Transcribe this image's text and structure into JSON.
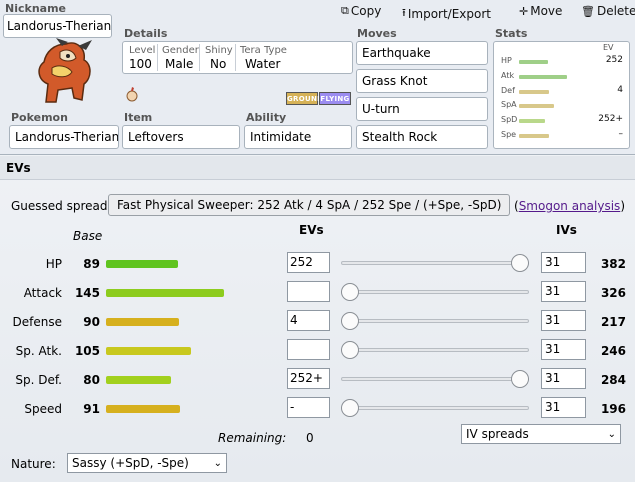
{
  "toolbar": {
    "copy": "Copy",
    "import_export": "Import/Export",
    "move": "Move",
    "delete": "Delete"
  },
  "set": {
    "nickname_label": "Nickname",
    "nickname": "Landorus-Therian",
    "details_label": "Details",
    "level_label": "Level",
    "level": "100",
    "gender_label": "Gender",
    "gender": "Male",
    "shiny_label": "Shiny",
    "shiny": "No",
    "tera_label": "Tera Type",
    "tera": "Water",
    "types": [
      "GROUND",
      "FLYING"
    ],
    "type_colors": [
      "#d6b257",
      "#9b8cf0"
    ],
    "pokemon_label": "Pokemon",
    "pokemon": "Landorus-Therian",
    "item_label": "Item",
    "item": "Leftovers",
    "ability_label": "Ability",
    "ability": "Intimidate",
    "moves_label": "Moves",
    "moves": [
      "Earthquake",
      "Grass Knot",
      "U-turn",
      "Stealth Rock"
    ],
    "stats_label": "Stats",
    "ev_label": "EV",
    "mini_stats": [
      {
        "name": "HP",
        "ev": "252"
      },
      {
        "name": "Atk",
        "ev": ""
      },
      {
        "name": "Def",
        "ev": "4"
      },
      {
        "name": "SpA",
        "ev": ""
      },
      {
        "name": "SpD",
        "ev": "252+"
      },
      {
        "name": "Spe",
        "ev": "–"
      }
    ]
  },
  "evs": {
    "header": "EVs",
    "guessed_label": "Guessed spread:",
    "guessed_value": "Fast Physical Sweeper: 252 Atk / 4 SpA / 252 Spe / (+Spe, -SpD)",
    "smogon_paren_open": "(",
    "smogon_link": "Smogon analysis",
    "smogon_paren_close": ")",
    "base_header": "Base",
    "evs_header": "EVs",
    "ivs_header": "IVs",
    "rows": [
      {
        "name": "HP",
        "base": "89",
        "ev": "252",
        "iv": "31",
        "total": "382",
        "ev_fraction": 1.0,
        "bar_color": "#5fc41f"
      },
      {
        "name": "Attack",
        "base": "145",
        "ev": "",
        "iv": "31",
        "total": "326",
        "ev_fraction": 0.0,
        "bar_color": "#8dcc1e"
      },
      {
        "name": "Defense",
        "base": "90",
        "ev": "4",
        "iv": "31",
        "total": "217",
        "ev_fraction": 0.0,
        "bar_color": "#d6b01e"
      },
      {
        "name": "Sp. Atk.",
        "base": "105",
        "ev": "",
        "iv": "31",
        "total": "246",
        "ev_fraction": 0.0,
        "bar_color": "#c8c81e"
      },
      {
        "name": "Sp. Def.",
        "base": "80",
        "ev": "252+",
        "iv": "31",
        "total": "284",
        "ev_fraction": 1.0,
        "bar_color": "#a2d01e"
      },
      {
        "name": "Speed",
        "base": "91",
        "ev": "-",
        "iv": "31",
        "total": "196",
        "ev_fraction": 0.0,
        "bar_color": "#d6b01e"
      }
    ],
    "remaining_label": "Remaining:",
    "remaining": "0",
    "iv_spreads": "IV spreads",
    "nature_label": "Nature:",
    "nature": "Sassy (+SpD, -Spe)"
  }
}
